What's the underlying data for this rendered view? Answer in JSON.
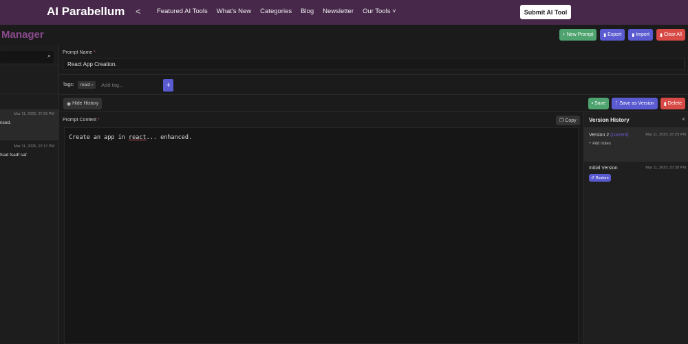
{
  "nav": {
    "logo": "AI Parabellum",
    "links": [
      "Featured AI Tools",
      "What's New",
      "Categories",
      "Blog",
      "Newsletter",
      "Our Tools"
    ],
    "submit": "Submit AI Tool"
  },
  "page": {
    "title": "Manager",
    "new_prompt": "New Prompt",
    "export": "Export",
    "import": "Import",
    "clear_all": "Clear All"
  },
  "sidebar": {
    "items": [
      {
        "date": "Mar 11, 2025, 07:29 PM",
        "text": "nced."
      },
      {
        "date": "Mar 11, 2025, 07:17 PM",
        "text": "fsad fsadf saf"
      }
    ]
  },
  "editor": {
    "name_label": "Prompt Name",
    "name_value": "React App Creation.",
    "tags_label": "Tags:",
    "tag": "react",
    "tag_placeholder": "Add tag...",
    "hide_history": "Hide History",
    "save": "Save",
    "save_version": "Save as Version",
    "delete": "Delete",
    "content_label": "Prompt Content",
    "copy": "Copy",
    "content_pre": "Create an app in ",
    "content_word": "react",
    "content_post": "... enhanced."
  },
  "history": {
    "title": "Version History",
    "versions": [
      {
        "name": "Version 2",
        "current": "(current)",
        "date": "Mar 11, 2025, 07:29 PM",
        "notes": "+ Add notes"
      },
      {
        "name": "Initial Version",
        "date": "Mar 11, 2025, 07:28 PM",
        "restore": "Restore"
      }
    ]
  },
  "colors": {
    "nav": "#47284a",
    "green": "#4ea36f",
    "blue": "#5a5bd0",
    "red": "#d74a45"
  }
}
